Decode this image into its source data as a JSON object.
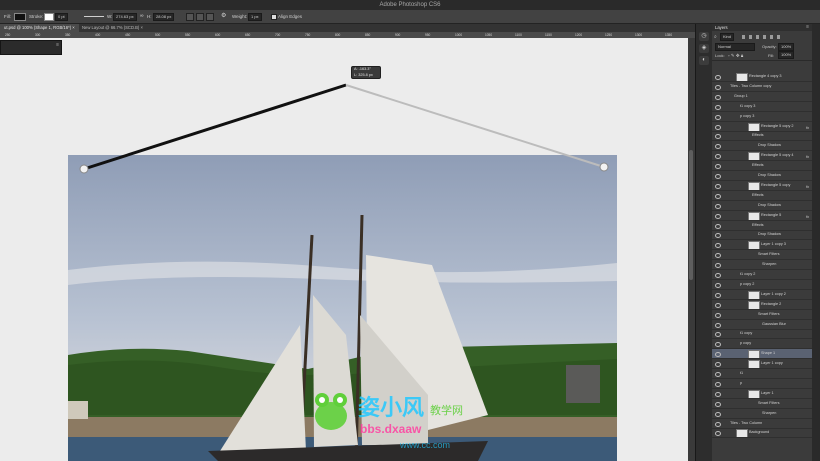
{
  "app": {
    "title": "Adobe Photoshop CS6"
  },
  "options_bar": {
    "fill_label": "Fill:",
    "stroke_label": "Stroke:",
    "stroke_size": "0 pt",
    "w_label": "W:",
    "w_value": "274.63 px",
    "h_label": "H:",
    "h_value": "28.08 px",
    "weight_label": "Weight:",
    "weight_value": "1 px",
    "align_edges_label": "Align Edges"
  },
  "tabs": [
    {
      "label": "ut.psd @ 100% (Shape 1, RGB/16*)"
    },
    {
      "label": "New Layout @ 66.7% (SCD.B)"
    }
  ],
  "ruler_ticks": [
    "250",
    "300",
    "350",
    "400",
    "450",
    "500",
    "550",
    "600",
    "650",
    "700",
    "750",
    "800",
    "850",
    "900",
    "950",
    "1000",
    "1050",
    "1100",
    "1150",
    "1200",
    "1250",
    "1300",
    "1350"
  ],
  "transform_tip": {
    "line1": "A: -163.3°",
    "line2": "L: 325.8 px"
  },
  "layers_panel": {
    "title": "Layers",
    "kind_label": "Kind",
    "blend_mode": "Normal",
    "opacity_label": "Opacity:",
    "opacity_value": "100%",
    "lock_label": "Lock:",
    "fill_label": "Fill:",
    "fill_value": "100%",
    "rows": [
      {
        "label": "Rectangle 4 copy 3",
        "indent": 14,
        "thumb": true,
        "fx": false
      },
      {
        "label": "Tiles - Two Column copy",
        "indent": 8,
        "thumb": false,
        "fx": false
      },
      {
        "label": "Group 1",
        "indent": 12,
        "thumb": false,
        "fx": false
      },
      {
        "label": "t1 copy 3",
        "indent": 18,
        "thumb": false,
        "fx": false
      },
      {
        "label": "p copy 3",
        "indent": 18,
        "thumb": false,
        "fx": false
      },
      {
        "label": "Rectangle 5 copy 2",
        "indent": 26,
        "thumb": true,
        "fx": true
      },
      {
        "label": "Effects",
        "indent": 30,
        "thumb": false,
        "fx": false
      },
      {
        "label": "Drop Shadow",
        "indent": 36,
        "thumb": false,
        "fx": false
      },
      {
        "label": "Rectangle 5 copy 4",
        "indent": 26,
        "thumb": true,
        "fx": true
      },
      {
        "label": "Effects",
        "indent": 30,
        "thumb": false,
        "fx": false
      },
      {
        "label": "Drop Shadow",
        "indent": 36,
        "thumb": false,
        "fx": false
      },
      {
        "label": "Rectangle 5 copy",
        "indent": 26,
        "thumb": true,
        "fx": true
      },
      {
        "label": "Effects",
        "indent": 30,
        "thumb": false,
        "fx": false
      },
      {
        "label": "Drop Shadow",
        "indent": 36,
        "thumb": false,
        "fx": false
      },
      {
        "label": "Rectangle 5",
        "indent": 26,
        "thumb": true,
        "fx": true
      },
      {
        "label": "Effects",
        "indent": 30,
        "thumb": false,
        "fx": false
      },
      {
        "label": "Drop Shadow",
        "indent": 36,
        "thumb": false,
        "fx": false
      },
      {
        "label": "Layer 1 copy 3",
        "indent": 26,
        "thumb": true,
        "fx": false
      },
      {
        "label": "Smart Filters",
        "indent": 36,
        "thumb": false,
        "fx": false
      },
      {
        "label": "Sharpen",
        "indent": 40,
        "thumb": false,
        "fx": false
      },
      {
        "label": "t1 copy 2",
        "indent": 18,
        "thumb": false,
        "fx": false
      },
      {
        "label": "p copy 2",
        "indent": 18,
        "thumb": false,
        "fx": false
      },
      {
        "label": "Layer 1 copy 2",
        "indent": 26,
        "thumb": true,
        "fx": false
      },
      {
        "label": "Rectangle 2",
        "indent": 26,
        "thumb": true,
        "fx": false
      },
      {
        "label": "Smart Filters",
        "indent": 36,
        "thumb": false,
        "fx": false
      },
      {
        "label": "Gaussian Blur",
        "indent": 40,
        "thumb": false,
        "fx": false
      },
      {
        "label": "t1 copy",
        "indent": 18,
        "thumb": false,
        "fx": false
      },
      {
        "label": "p copy",
        "indent": 18,
        "thumb": false,
        "fx": false
      },
      {
        "label": "Shape 1",
        "indent": 26,
        "thumb": true,
        "fx": false
      },
      {
        "label": "Layer 1 copy",
        "indent": 26,
        "thumb": true,
        "fx": false
      },
      {
        "label": "t1",
        "indent": 18,
        "thumb": false,
        "fx": false
      },
      {
        "label": "p",
        "indent": 18,
        "thumb": false,
        "fx": false
      },
      {
        "label": "Layer 1",
        "indent": 26,
        "thumb": true,
        "fx": false
      },
      {
        "label": "Smart Filters",
        "indent": 36,
        "thumb": false,
        "fx": false
      },
      {
        "label": "Sharpen",
        "indent": 40,
        "thumb": false,
        "fx": false
      },
      {
        "label": "Tiles - Two Column",
        "indent": 8,
        "thumb": false,
        "fx": false
      },
      {
        "label": "Background",
        "indent": 14,
        "thumb": true,
        "fx": false
      }
    ]
  },
  "watermark": {
    "brand": "姿小风",
    "brand_suffix": "教学网",
    "url_line": "bbs.dxaaw",
    "url_line2": "www.cc.com"
  },
  "colors": {
    "canvas_bg": "#ececec",
    "panel_bg": "#3b3b3b",
    "selected_row": "#5a6272"
  }
}
